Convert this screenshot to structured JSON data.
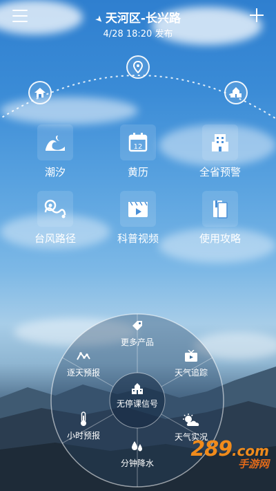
{
  "header": {
    "location": "天河区-长兴路",
    "publish_time": "4/28 18:20 发布"
  },
  "arc_nodes": [
    {
      "name": "home",
      "icon": "home-icon"
    },
    {
      "name": "location",
      "icon": "location-pin-icon"
    },
    {
      "name": "building",
      "icon": "building-icon"
    }
  ],
  "grid": [
    {
      "label": "潮汐",
      "icon": "wave-moon-icon"
    },
    {
      "label": "黄历",
      "icon": "calendar-icon",
      "icon_text": "12"
    },
    {
      "label": "全省预警",
      "icon": "building-icon"
    },
    {
      "label": "台风路径",
      "icon": "typhoon-path-icon"
    },
    {
      "label": "科普视频",
      "icon": "video-icon"
    },
    {
      "label": "使用攻略",
      "icon": "book-icon"
    }
  ],
  "wheel": {
    "segments": [
      {
        "label": "更多产品",
        "icon": "tag-icon"
      },
      {
        "label": "天气追踪",
        "icon": "tv-icon"
      },
      {
        "label": "天气实况",
        "icon": "sun-cloud-icon"
      },
      {
        "label": "分钟降水",
        "icon": "raindrops-icon"
      },
      {
        "label": "小时预报",
        "icon": "thermometer-icon"
      },
      {
        "label": "逐天预报",
        "icon": "line-chart-icon"
      }
    ],
    "center": {
      "label": "无停课信号",
      "icon": "school-icon"
    }
  },
  "watermark": {
    "main": "289",
    "suffix": ".com",
    "sub": "手游网"
  },
  "colors": {
    "sky_top": "#2f7fcf",
    "watermark": "#f08b1c"
  }
}
